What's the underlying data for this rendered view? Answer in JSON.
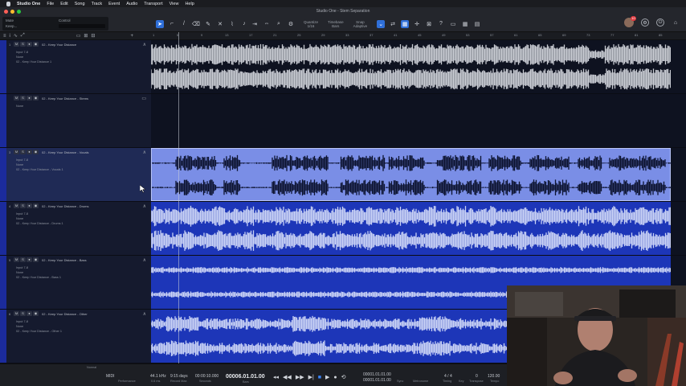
{
  "menubar": {
    "items": [
      "Studio One",
      "File",
      "Edit",
      "Song",
      "Track",
      "Event",
      "Audio",
      "Transport",
      "View",
      "Help"
    ]
  },
  "window": {
    "title": "Studio One - Stem Separation"
  },
  "song_box": {
    "mute_label": "Mute",
    "song_label": "Keep...",
    "control_label": "Control"
  },
  "toolbar": {
    "quantize_label": "Quantize",
    "quantize_value": "1/16",
    "timebase_label": "Timebase",
    "timebase_value": "Bars",
    "snap_label": "Snap",
    "snap_value": "Adaptive",
    "notifications_count": "10"
  },
  "ruler": {
    "ticks": [
      "1",
      "5",
      "9",
      "13",
      "17",
      "21",
      "25",
      "29",
      "33",
      "37",
      "41",
      "45",
      "49",
      "53",
      "57",
      "61",
      "65",
      "69",
      "73",
      "77",
      "81",
      "85"
    ]
  },
  "tracks": [
    {
      "number": "1",
      "name": "02 - Keep Your Distance",
      "input": "Input 7-8",
      "none_label": "None",
      "output": "02 - Keep Your Distance 1",
      "state": "normal"
    },
    {
      "number": "",
      "name": "02 - Keep Your Distance - Stems",
      "input": "None",
      "none_label": "",
      "output": "",
      "state": "folder"
    },
    {
      "number": "3",
      "name": "02 - Keep Your Distance - Vocals",
      "input": "Input 7-8",
      "none_label": "None",
      "output": "02 - Keep Your Distance - Vocals 1",
      "state": "selected"
    },
    {
      "number": "4",
      "name": "02 - Keep Your Distance - Drums",
      "input": "Input 7-8",
      "none_label": "None",
      "output": "02 - Keep Your Distance - Drums 1",
      "state": "normal"
    },
    {
      "number": "5",
      "name": "02 - Keep Your Distance - Bass",
      "input": "Input 7-8",
      "none_label": "None",
      "output": "02 - Keep Your Distance - Bass 1",
      "state": "normal"
    },
    {
      "number": "6",
      "name": "02 - Keep Your Distance - Other",
      "input": "Input 7-8",
      "none_label": "None",
      "output": "02 - Keep Your Distance - Other 1",
      "state": "normal"
    }
  ],
  "track_buttons": {
    "mute": "M",
    "solo": "S",
    "record": "●",
    "monitor": "◉"
  },
  "bottom": {
    "midi_label": "MIDI",
    "performance_label": "Performance",
    "sample_rate": "44.1 kHz",
    "sample_rate_sub": "0.6 ms",
    "record_time": "9:15 days",
    "record_time_sub": "Record Max",
    "seconds": "00:00:10.000",
    "seconds_sub": "Seconds",
    "position": "00006.01.01.00",
    "position_sub": "Bars",
    "loop_start": "00001.01.01.00",
    "loop_end": "00001.01.01.00",
    "sync_label": "Sync",
    "metronome_label": "Metronome",
    "time_sig": "4 / 4",
    "timing_label": "Timing",
    "key_label": "Key",
    "transpose": "0",
    "transpose_label": "Transpose",
    "tempo": "120.00",
    "tempo_label": "Tempo",
    "mode_label": "Normal"
  },
  "colors": {
    "track_blue": "#1b2b9c",
    "clip_blue": "#1d36b8",
    "selected_clip": "#7b8fe0",
    "accent": "#2f6fd8"
  }
}
